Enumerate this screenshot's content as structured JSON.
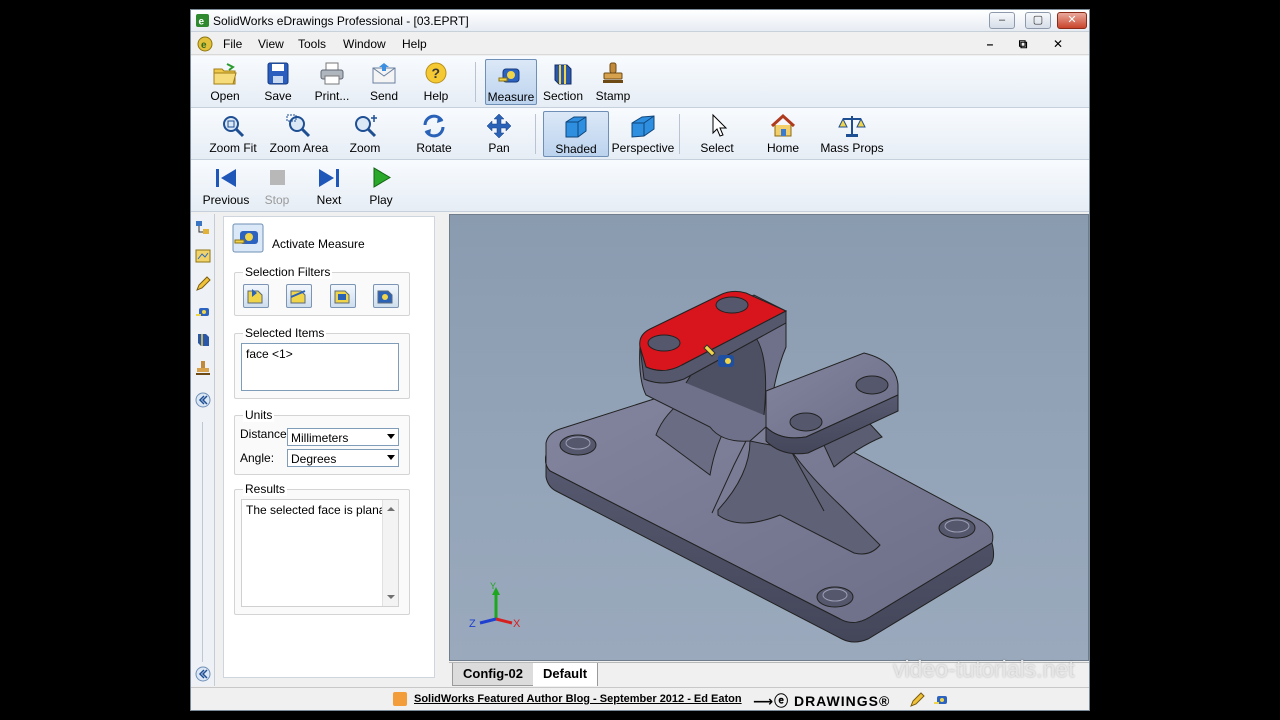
{
  "window": {
    "title": "SolidWorks eDrawings Professional - [03.EPRT]",
    "min_glyph": "–",
    "max_glyph": "▢",
    "close_glyph": "✕",
    "mdi_min_glyph": "–",
    "mdi_restore_glyph": "⧉",
    "mdi_close_glyph": "✕"
  },
  "menu": [
    "File",
    "View",
    "Tools",
    "Window",
    "Help"
  ],
  "toolbar_main": {
    "open": "Open",
    "save": "Save",
    "print": "Print...",
    "send": "Send",
    "help": "Help",
    "measure": "Measure",
    "section": "Section",
    "stamp": "Stamp"
  },
  "toolbar_view": {
    "zoom_fit": "Zoom Fit",
    "zoom_area": "Zoom Area",
    "zoom": "Zoom",
    "rotate": "Rotate",
    "pan": "Pan",
    "shaded": "Shaded",
    "perspective": "Perspective",
    "select": "Select",
    "home": "Home",
    "mass_props": "Mass Props"
  },
  "toolbar_play": {
    "previous": "Previous",
    "stop": "Stop",
    "next": "Next",
    "play": "Play"
  },
  "measure_panel": {
    "activate_label": "Activate Measure",
    "selection_filters_title": "Selection Filters",
    "selected_items_title": "Selected Items",
    "selected_items": [
      "face <1>"
    ],
    "units_title": "Units",
    "distance_label": "Distance:",
    "distance_value": "Millimeters",
    "angle_label": "Angle:",
    "angle_value": "Degrees",
    "results_title": "Results",
    "results_text": "The selected face is planar."
  },
  "triad": {
    "x": "X",
    "y": "Y",
    "z": "Z"
  },
  "config_tabs": [
    "Config-02",
    "Default"
  ],
  "statusbar": {
    "blog": "SolidWorks Featured Author Blog - September 2012 - Ed Eaton",
    "logo": "⟶ⓔ DRAWINGS®"
  },
  "watermark": "video-tutorials.net",
  "colors": {
    "selected_face": "#d8141c",
    "part_body": "#6e6f85",
    "viewport_bg": "#8f9fb4",
    "accent": "#3a6ea5"
  }
}
